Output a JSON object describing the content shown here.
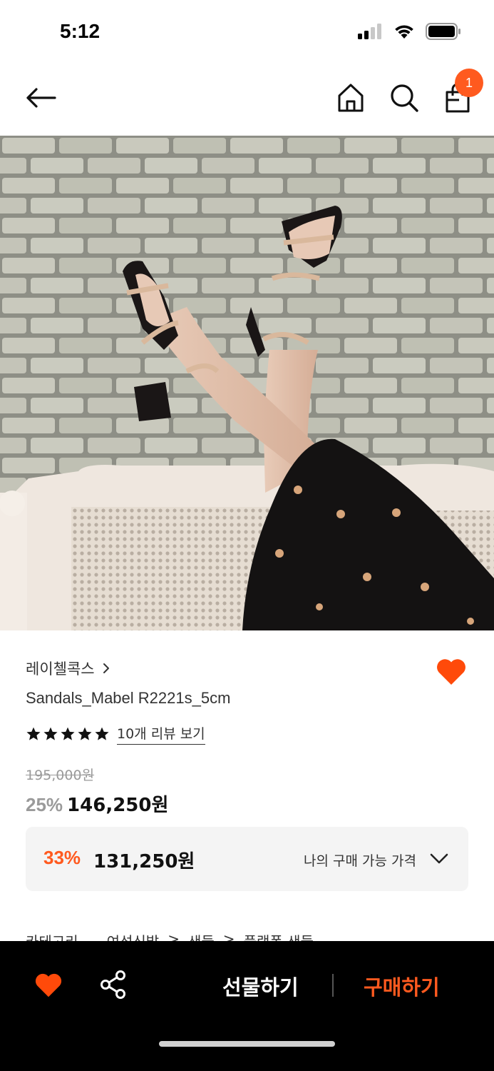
{
  "status_bar": {
    "time": "5:12"
  },
  "nav": {
    "cart_count": "1"
  },
  "product": {
    "brand": "레이첼콕스",
    "name": "Sandals_Mabel R2221s_5cm",
    "rating_stars": 5,
    "review_link": "10개 리뷰 보기",
    "original_price": "195,000원",
    "discount_percent": "25%",
    "sale_price": "146,250원"
  },
  "my_price": {
    "discount_percent": "33%",
    "price": "131,250원",
    "label": "나의 구매 가능 가격"
  },
  "category": {
    "label": "카테고리",
    "path": [
      "여성신발",
      ">",
      "샌들",
      ">",
      "플랫폼 샌들"
    ]
  },
  "bottom_bar": {
    "gift_label": "선물하기",
    "buy_label": "구매하기"
  },
  "colors": {
    "accent": "#ff5a1f",
    "wish": "#ff4a0a"
  }
}
